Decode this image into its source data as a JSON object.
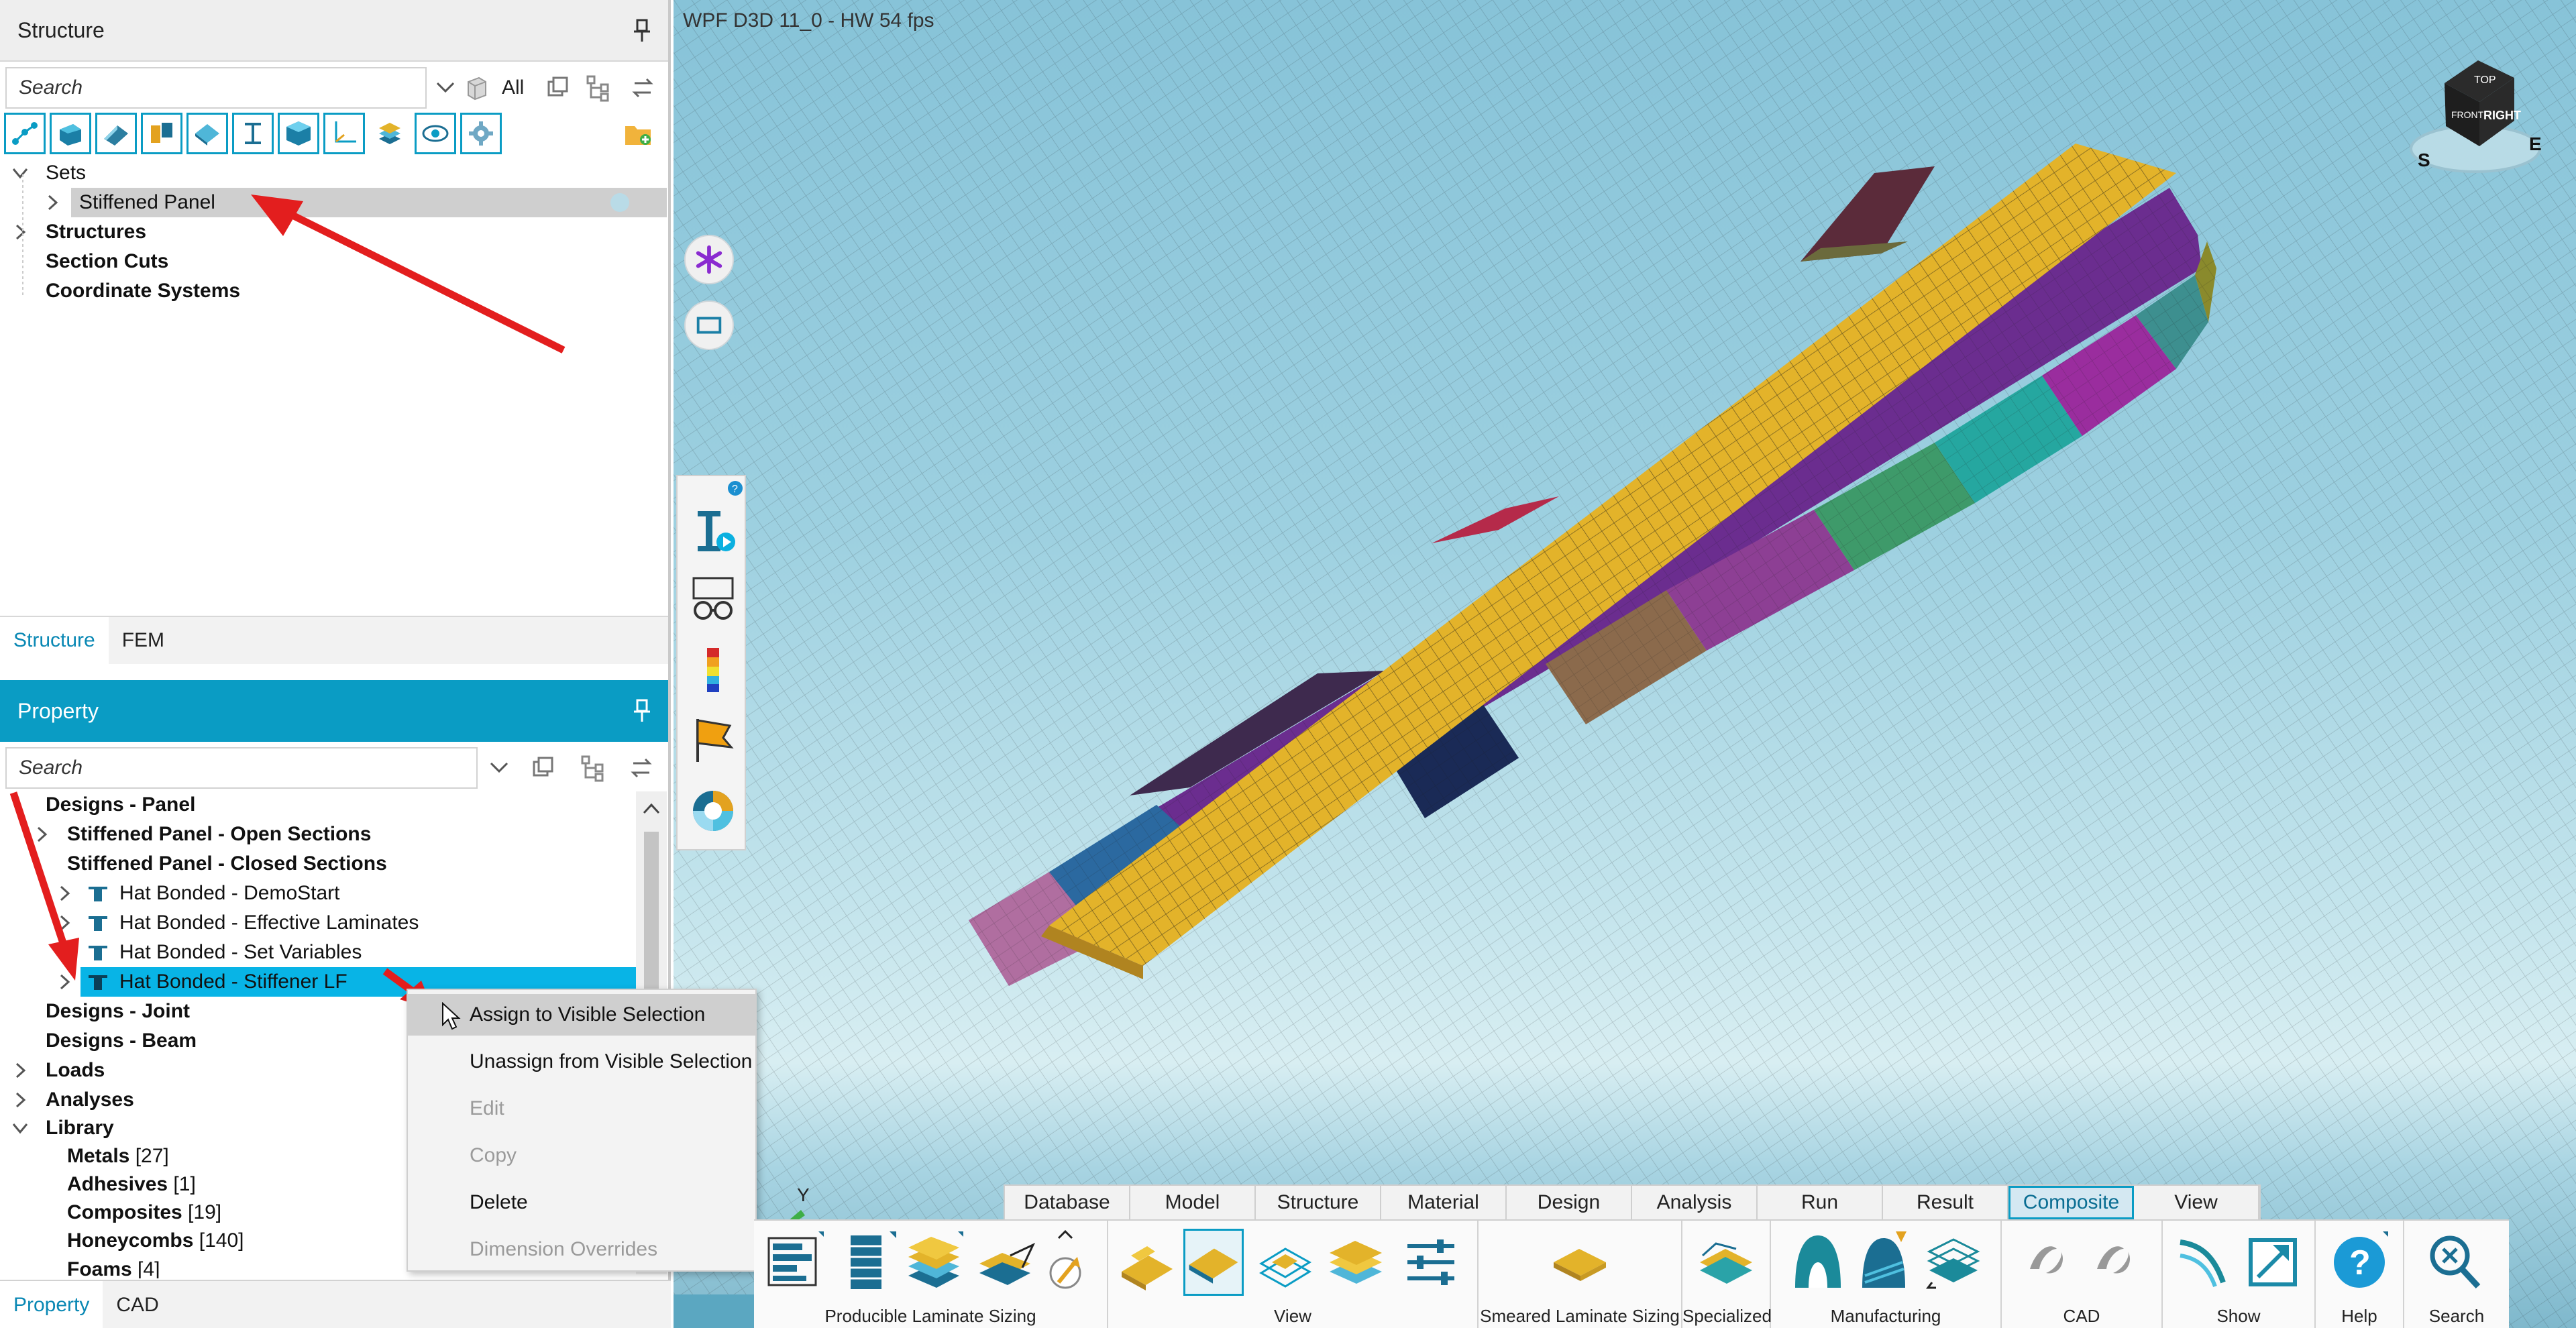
{
  "structure_panel": {
    "title": "Structure",
    "search_placeholder": "Search",
    "filter_label": "All",
    "tree": [
      {
        "label": "Sets",
        "expanded": true
      },
      {
        "label": "Stiffened Panel",
        "selected": true
      },
      {
        "label": "Structures"
      },
      {
        "label": "Section Cuts"
      },
      {
        "label": "Coordinate Systems"
      }
    ],
    "tabs": [
      "Structure",
      "FEM"
    ]
  },
  "property_panel": {
    "title": "Property",
    "search_placeholder": "Search",
    "tree": [
      {
        "label": "Designs - Panel"
      },
      {
        "label": "Stiffened Panel - Open Sections"
      },
      {
        "label": "Stiffened Panel - Closed Sections"
      },
      {
        "label": "Hat Bonded - DemoStart"
      },
      {
        "label": "Hat Bonded - Effective Laminates"
      },
      {
        "label": "Hat Bonded - Set Variables"
      },
      {
        "label": "Hat Bonded - Stiffener LF",
        "selected": true
      },
      {
        "label": "Designs - Joint"
      },
      {
        "label": "Designs - Beam"
      },
      {
        "label": "Loads"
      },
      {
        "label": "Analyses"
      },
      {
        "label": "Library"
      },
      {
        "label": "Metals",
        "count": "[27]"
      },
      {
        "label": "Adhesives",
        "count": "[1]"
      },
      {
        "label": "Composites",
        "count": "[19]"
      },
      {
        "label": "Honeycombs",
        "count": "[140]"
      },
      {
        "label": "Foams",
        "count": "[4]"
      }
    ],
    "tabs": [
      "Property",
      "CAD"
    ]
  },
  "context_menu": {
    "items": [
      {
        "label": "Assign to Visible Selection",
        "state": "hover"
      },
      {
        "label": "Unassign from Visible Selection",
        "state": "enabled"
      },
      {
        "label": "Edit",
        "state": "disabled"
      },
      {
        "label": "Copy",
        "state": "disabled"
      },
      {
        "label": "Delete",
        "state": "enabled"
      },
      {
        "label": "Dimension Overrides",
        "state": "disabled"
      }
    ]
  },
  "viewport": {
    "status": "WPF D3D 11_0 - HW  54 fps",
    "axis_label": "Y",
    "view_cube": {
      "faces": [
        "TOP",
        "FRONT",
        "RIGHT"
      ],
      "compass": [
        "S",
        "E"
      ]
    }
  },
  "ribbon": {
    "tabs": [
      {
        "label": "Database"
      },
      {
        "label": "Model"
      },
      {
        "label": "Structure"
      },
      {
        "label": "Material"
      },
      {
        "label": "Design"
      },
      {
        "label": "Analysis"
      },
      {
        "label": "Run"
      },
      {
        "label": "Result"
      },
      {
        "label": "Composite",
        "active": true
      },
      {
        "label": "View"
      }
    ],
    "groups": [
      "Producible Laminate Sizing",
      "View",
      "Smeared Laminate Sizing",
      "Specialized",
      "Manufacturing",
      "CAD",
      "Show",
      "Help",
      "Search"
    ]
  },
  "colors": {
    "accent": "#0a9cc4",
    "selection": "#08b4e6",
    "tree_selected": "#cfcfcf",
    "annotation_arrow": "#e31e1e",
    "panel_yellow": "#e3b32a"
  }
}
